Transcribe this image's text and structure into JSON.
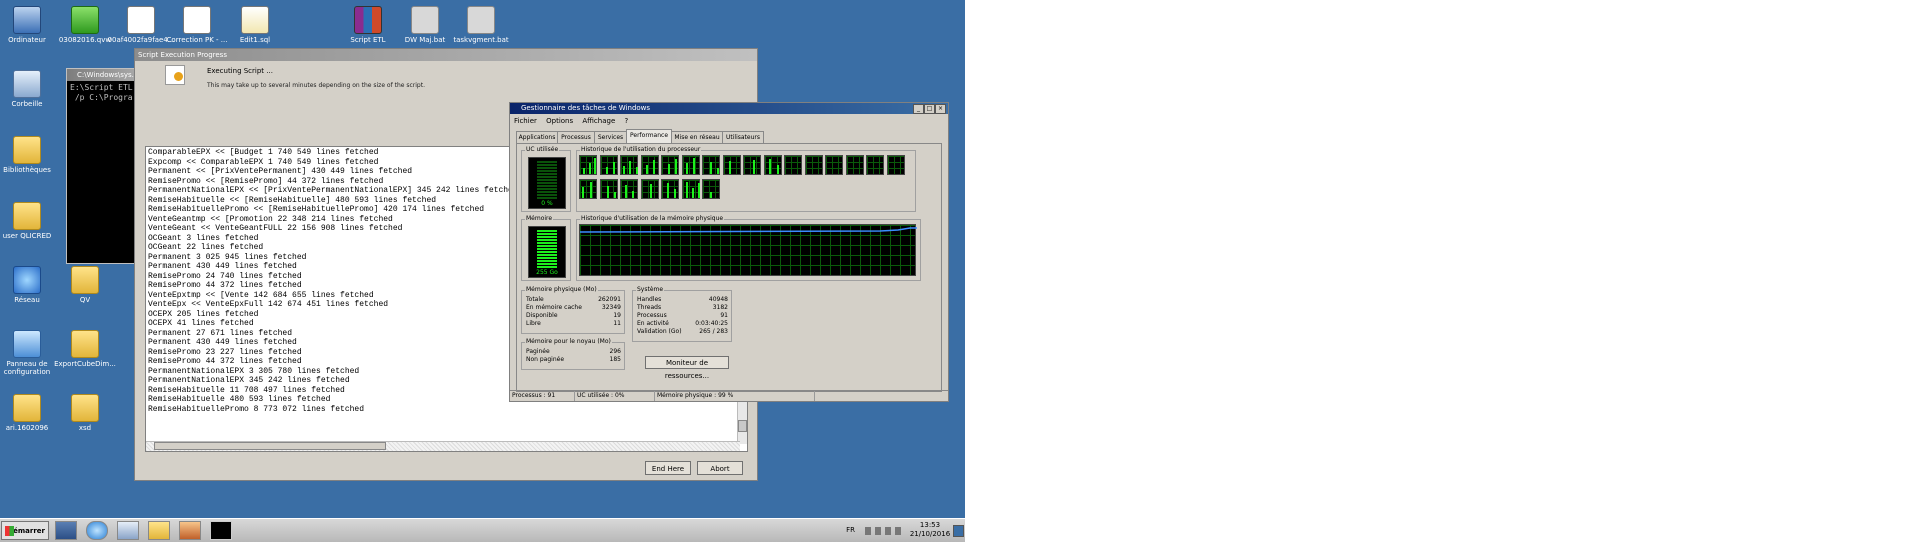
{
  "desktop": {
    "icons": [
      {
        "label": "Ordinateur",
        "icon": "computer-icon"
      },
      {
        "label": "03082016.qvw",
        "icon": "qvw-file-icon"
      },
      {
        "label": "00af4002fa9fae4...",
        "icon": "text-file-icon"
      },
      {
        "label": "Correction PK - ...",
        "icon": "text-file-icon"
      },
      {
        "label": "Edit1.sql",
        "icon": "sql-file-icon"
      },
      {
        "label": "Script ETL",
        "icon": "rar-archive-icon"
      },
      {
        "label": "DW Maj.bat",
        "icon": "batch-file-icon"
      },
      {
        "label": "taskvgment.bat",
        "icon": "batch-file-icon"
      },
      {
        "label": "Corbeille",
        "icon": "recycle-bin-icon"
      },
      {
        "label": "Bibliothèques",
        "icon": "libraries-icon"
      },
      {
        "label": "user QLICRED",
        "icon": "user-folder-icon"
      },
      {
        "label": "Réseau",
        "icon": "network-icon"
      },
      {
        "label": "QV",
        "icon": "folder-icon"
      },
      {
        "label": "Panneau de configuration",
        "icon": "control-panel-icon"
      },
      {
        "label": "ExportCubeDim...",
        "icon": "folder-icon"
      },
      {
        "label": "ari.1602096",
        "icon": "folder-icon"
      },
      {
        "label": "xsd",
        "icon": "folder-icon"
      }
    ]
  },
  "cmd": {
    "title": "C:\\Windows\\sys...",
    "lines": [
      "E:\\Script ETL",
      " /p C:\\Progra"
    ]
  },
  "script_dialog": {
    "title": "Script Execution Progress",
    "executing": "Executing Script ...",
    "note": "This may take up to several minutes depending on the size of the script.",
    "log": [
      "ComparableEPX << [Budget 1 740 549 lines fetched",
      "Expcomp << ComparableEPX 1 740 549 lines fetched",
      "Permanent << [PrixVentePermanent] 430 449 lines fetched",
      "RemisePromo << [RemisePromo] 44 372 lines fetched",
      "PermanentNationalEPX << [PrixVentePermanentNationalEPX] 345 242 lines fetched",
      "RemiseHabituelle << [RemiseHabituelle] 480 593 lines fetched",
      "RemiseHabituellePromo << [RemiseHabituellePromo] 420 174 lines fetched",
      "VenteGeantmp << [Promotion 22 348 214 lines fetched",
      "VenteGeant << VenteGeantFULL 22 156 908 lines fetched",
      "OCGeant 3 lines fetched",
      "OCGeant 22 lines fetched",
      "Permanent 3 025 945 lines fetched",
      "Permanent 430 449 lines fetched",
      "RemisePromo 24 740 lines fetched",
      "RemisePromo 44 372 lines fetched",
      "VenteEpxtmp << [Vente 142 684 655 lines fetched",
      "VenteEpx << VenteEpxFull 142 674 451 lines fetched",
      "OCEPX 205 lines fetched",
      "OCEPX 41 lines fetched",
      "Permanent 27 671 lines fetched",
      "Permanent 430 449 lines fetched",
      "RemisePromo 23 227 lines fetched",
      "RemisePromo 44 372 lines fetched",
      "PermanentNationalEPX 3 305 780 lines fetched",
      "PermanentNationalEPX 345 242 lines fetched",
      "RemiseHabituelle 11 708 497 lines fetched",
      "RemiseHabituelle 480 593 lines fetched",
      "RemiseHabituellePromo 8 773 072 lines fetched"
    ],
    "end_here_label": "End Here",
    "abort_label": "Abort"
  },
  "task_manager": {
    "title": "Gestionnaire des tâches de Windows",
    "menu": [
      "Fichier",
      "Options",
      "Affichage",
      "?"
    ],
    "tabs": [
      "Applications",
      "Processus",
      "Services",
      "Performance",
      "Mise en réseau",
      "Utilisateurs"
    ],
    "active_tab": "Performance",
    "cpu_usage_caption": "UC utilisée",
    "cpu_usage_value": "0 %",
    "cpu_usage_fraction": 0.0,
    "cpu_history_caption": "Historique de l'utilisation du processeur",
    "memory_caption": "Mémoire",
    "memory_value": "255 Go",
    "memory_fraction": 0.99,
    "memory_history_caption": "Historique d'utilisation de la mémoire physique",
    "physical_memory": {
      "caption": "Mémoire physique (Mo)",
      "rows": [
        {
          "label": "Totale",
          "value": "262091"
        },
        {
          "label": "En mémoire cache",
          "value": "32349"
        },
        {
          "label": "Disponible",
          "value": "19"
        },
        {
          "label": "Libre",
          "value": "11"
        }
      ]
    },
    "kernel_memory": {
      "caption": "Mémoire pour le noyau (Mo)",
      "rows": [
        {
          "label": "Paginée",
          "value": "296"
        },
        {
          "label": "Non paginée",
          "value": "185"
        }
      ]
    },
    "system": {
      "caption": "Système",
      "rows": [
        {
          "label": "Handles",
          "value": "40948"
        },
        {
          "label": "Threads",
          "value": "3182"
        },
        {
          "label": "Processus",
          "value": "91"
        },
        {
          "label": "En activité",
          "value": "0:03:40:25"
        },
        {
          "label": "Validation (Go)",
          "value": "265 / 283"
        }
      ]
    },
    "resource_monitor_label": "Moniteur de ressources...",
    "status": {
      "processes": "Processus : 91",
      "cpu": "UC utilisée : 0%",
      "memory": "Mémoire physique : 99 %"
    }
  },
  "taskbar": {
    "start_label": "Démarrer",
    "language": "FR",
    "time": "13:53",
    "date": "21/10/2016"
  }
}
